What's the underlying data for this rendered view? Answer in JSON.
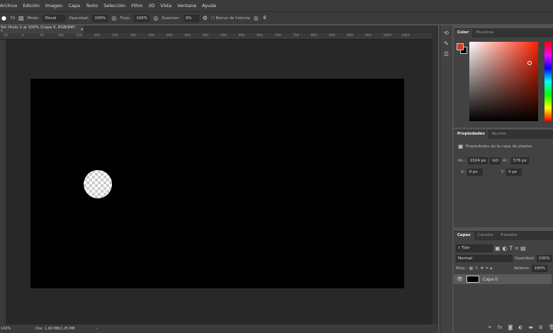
{
  "menu": [
    "Archivo",
    "Edición",
    "Imagen",
    "Capa",
    "Texto",
    "Selección",
    "Filtro",
    "3D",
    "Vista",
    "Ventana",
    "Ayuda"
  ],
  "options": {
    "brush_size": "70",
    "mode_label": "Modo:",
    "mode": "Pincel",
    "opacity_label": "Opacidad:",
    "opacity": "100%",
    "flow_label": "Flujo:",
    "flow": "100%",
    "smooth_label": "Suavizar:",
    "smooth": "0%",
    "erase_history": "Borrar de historia"
  },
  "document": {
    "tab": "Sin título-1 al 100% (Capa 0, RGB/8#) *",
    "close": "×"
  },
  "ruler": [
    "50",
    "0",
    "50",
    "100",
    "150",
    "200",
    "250",
    "300",
    "350",
    "400",
    "450",
    "500",
    "550",
    "600",
    "650",
    "700",
    "750",
    "800",
    "850",
    "900",
    "950",
    "1000",
    "1050"
  ],
  "status": {
    "zoom": "100%",
    "doc": "Doc: 1,69 MB/2,25 MB",
    "arrow": "›"
  },
  "color_panel": {
    "tabs": [
      "Color",
      "Muestras"
    ],
    "foreground": "#d83a1a",
    "background": "#000000"
  },
  "properties": {
    "tabs": [
      "Propiedades",
      "Ajustes"
    ],
    "title": "Propiedades de la capa de píxeles",
    "width_label": "An.:",
    "width": "1024 px",
    "link": "GO",
    "height_label": "Al.:",
    "height": "576 px",
    "x_label": "X:",
    "x": "0 px",
    "y_label": "Y:",
    "y": "0 px"
  },
  "layers": {
    "tabs": [
      "Capas",
      "Canales",
      "Trazados"
    ],
    "filter": "Tipo",
    "blend": "Normal",
    "opacity_label": "Opacidad:",
    "opacity": "100%",
    "lock_label": "Bloq.:",
    "fill_label": "Relleno:",
    "fill": "100%",
    "items": [
      {
        "name": "Capa 0",
        "visible": true
      }
    ]
  }
}
